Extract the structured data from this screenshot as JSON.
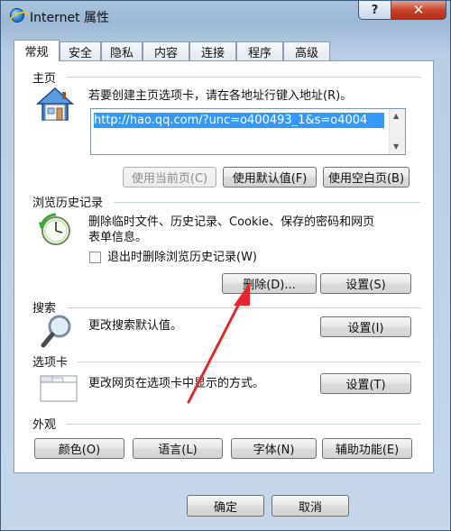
{
  "window": {
    "title": "Internet 属性",
    "help": "?",
    "close": "✕"
  },
  "tabs": [
    "常规",
    "安全",
    "隐私",
    "内容",
    "连接",
    "程序",
    "高级"
  ],
  "home": {
    "title": "主页",
    "description": "若要创建主页选项卡，请在各地址行键入地址(R)。",
    "url": "http://hao.qq.com/?unc=o400493_1&s=o4004",
    "btn_current": "使用当前页(C)",
    "btn_default": "使用默认值(F)",
    "btn_blank": "使用空白页(B)"
  },
  "history": {
    "title": "浏览历史记录",
    "desc_line1": "删除临时文件、历史记录、Cookie、保存的密码和网页",
    "desc_line2": "表单信息。",
    "checkbox_label": "退出时删除浏览历史记录(W)",
    "btn_delete": "删除(D)...",
    "btn_settings": "设置(S)"
  },
  "search": {
    "title": "搜索",
    "description": "更改搜索默认值。",
    "btn_settings": "设置(I)"
  },
  "tabs_section": {
    "title": "选项卡",
    "description": "更改网页在选项卡中显示的方式。",
    "btn_settings": "设置(T)"
  },
  "appearance": {
    "title": "外观",
    "btn_colors": "颜色(O)",
    "btn_languages": "语言(L)",
    "btn_fonts": "字体(N)",
    "btn_accessibility": "辅助功能(E)"
  },
  "footer": {
    "ok": "确定",
    "cancel": "取消"
  },
  "colors": {
    "selection": "#3399ff",
    "close_button": "#c7432c",
    "arrow": "#e8252c"
  }
}
